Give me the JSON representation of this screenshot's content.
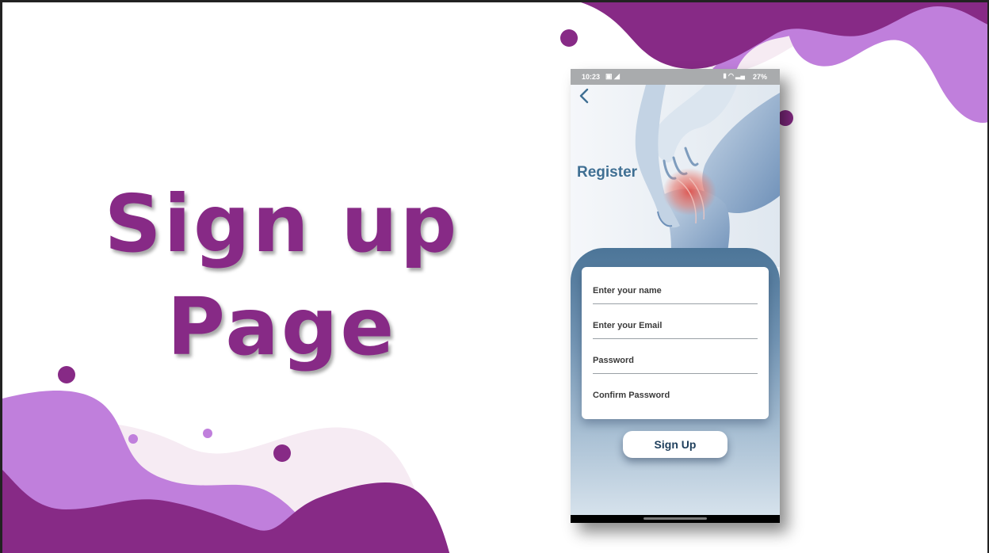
{
  "slide": {
    "title_line1": "Sign up",
    "title_line2": "Page"
  },
  "colors": {
    "brand_purple": "#872a86",
    "light_purple": "#c07fdc",
    "pale_pink": "#f6ebf3",
    "register_blue": "#3f6f93",
    "button_text": "#1f3f5c"
  },
  "phone": {
    "status_bar": {
      "time": "10:23",
      "battery": "27%"
    },
    "back_icon": "chevron-left-icon",
    "screen_title": "Register",
    "form": {
      "name_placeholder": "Enter your name",
      "email_placeholder": "Enter your Email",
      "password_placeholder": "Password",
      "confirm_password_placeholder": "Confirm Password"
    },
    "signup_label": "Sign Up"
  }
}
